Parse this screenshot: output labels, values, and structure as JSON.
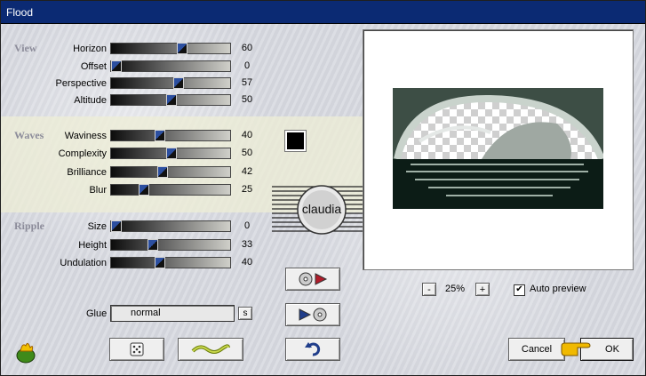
{
  "window": {
    "title": "Flood"
  },
  "groups": [
    {
      "name": "View",
      "rows": [
        {
          "label": "Horizon",
          "value": "60",
          "pos": 60
        },
        {
          "label": "Offset",
          "value": "0",
          "pos": 0
        },
        {
          "label": "Perspective",
          "value": "57",
          "pos": 57
        },
        {
          "label": "Altitude",
          "value": "50",
          "pos": 50
        }
      ]
    },
    {
      "name": "Waves",
      "rows": [
        {
          "label": "Waviness",
          "value": "40",
          "pos": 40
        },
        {
          "label": "Complexity",
          "value": "50",
          "pos": 50
        },
        {
          "label": "Brilliance",
          "value": "42",
          "pos": 42
        },
        {
          "label": "Blur",
          "value": "25",
          "pos": 25
        }
      ]
    },
    {
      "name": "Ripple",
      "rows": [
        {
          "label": "Size",
          "value": "0",
          "pos": 0
        },
        {
          "label": "Height",
          "value": "33",
          "pos": 33
        },
        {
          "label": "Undulation",
          "value": "40",
          "pos": 40
        }
      ]
    }
  ],
  "glue": {
    "label": "Glue",
    "value": "normal",
    "lock_label": "s"
  },
  "logo_text": "claudia",
  "zoom": {
    "minus": "-",
    "value": "25%",
    "plus": "+"
  },
  "auto_preview": {
    "label": "Auto preview",
    "checked": true,
    "mark": "✔"
  },
  "buttons": {
    "cancel": "Cancel",
    "ok": "OK"
  },
  "colors": {
    "accent": "#0b2a73",
    "preview_water": "#0c1c16"
  }
}
